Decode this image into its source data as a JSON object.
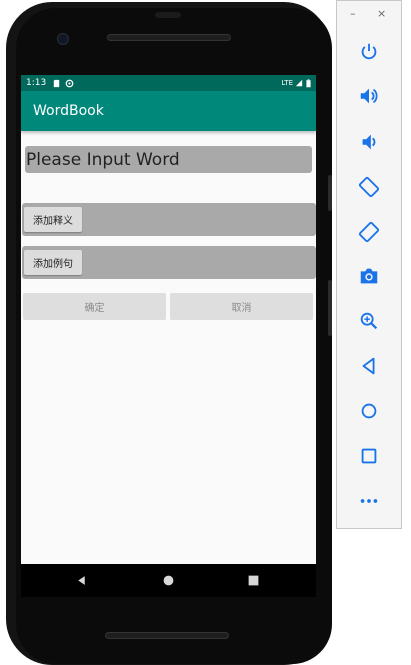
{
  "status_bar": {
    "time": "1:13",
    "network": "LTE"
  },
  "app": {
    "title": "WordBook"
  },
  "form": {
    "word_placeholder": "Please Input Word",
    "add_meaning_label": "添加释义",
    "add_example_label": "添加例句",
    "confirm_label": "确定",
    "cancel_label": "取消"
  },
  "nav_bar": {
    "icons": [
      "back-icon",
      "home-icon",
      "recents-icon"
    ]
  },
  "emulator_panel": {
    "minimize_label": "–",
    "close_label": "×",
    "tools": [
      "power-icon",
      "volume-up-icon",
      "volume-down-icon",
      "rotate-left-icon",
      "rotate-right-icon",
      "camera-icon",
      "zoom-icon",
      "back-icon",
      "home-icon",
      "overview-icon",
      "more-icon"
    ]
  },
  "colors": {
    "status_bar": "#00695c",
    "app_bar": "#00897b",
    "screen_bg": "#fafafa",
    "input_bg": "#a9a9a9",
    "emulator_icon": "#1a73e8"
  }
}
